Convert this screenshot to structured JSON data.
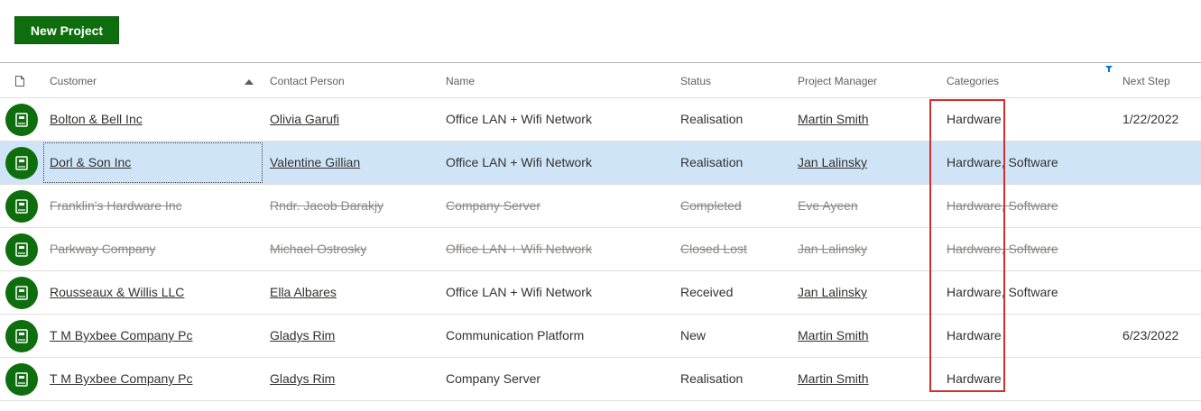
{
  "toolbar": {
    "new_project_label": "New Project"
  },
  "columns": {
    "customer": "Customer",
    "contact": "Contact Person",
    "name": "Name",
    "status": "Status",
    "manager": "Project Manager",
    "categories": "Categories",
    "next_step": "Next Step"
  },
  "rows": [
    {
      "customer": "Bolton & Bell Inc",
      "contact": "Olivia Garufi",
      "name": "Office LAN + Wifi Network",
      "status": "Realisation",
      "manager": "Martin Smith",
      "categories": "Hardware",
      "next_step": "1/22/2022"
    },
    {
      "customer": "Dorl & Son Inc",
      "contact": "Valentine Gillian",
      "name": "Office LAN + Wifi Network",
      "status": "Realisation",
      "manager": "Jan Lalinsky",
      "categories": "Hardware, Software",
      "next_step": ""
    },
    {
      "customer": "Franklin's Hardware Inc",
      "contact": "Rndr. Jacob Darakjy",
      "name": "Company Server",
      "status": "Completed",
      "manager": "Eve Ayeen",
      "categories": "Hardware, Software",
      "next_step": ""
    },
    {
      "customer": "Parkway Company",
      "contact": "Michael Ostrosky",
      "name": "Office LAN + Wifi Network",
      "status": "Closed Lost",
      "manager": "Jan Lalinsky",
      "categories": "Hardware, Software",
      "next_step": ""
    },
    {
      "customer": "Rousseaux & Willis LLC",
      "contact": "Ella Albares",
      "name": "Office LAN + Wifi Network",
      "status": "Received",
      "manager": "Jan Lalinsky",
      "categories": "Hardware, Software",
      "next_step": ""
    },
    {
      "customer": "T M Byxbee Company Pc",
      "contact": "Gladys Rim",
      "name": "Communication Platform",
      "status": "New",
      "manager": "Martin Smith",
      "categories": "Hardware",
      "next_step": "6/23/2022"
    },
    {
      "customer": "T M Byxbee Company Pc",
      "contact": "Gladys Rim",
      "name": "Company Server",
      "status": "Realisation",
      "manager": "Martin Smith",
      "categories": "Hardware",
      "next_step": ""
    }
  ],
  "colors": {
    "accent": "#0e6e0e",
    "selected_row": "#cfe4f7",
    "highlight": "#d32f2f",
    "filter_icon": "#0078d4"
  }
}
